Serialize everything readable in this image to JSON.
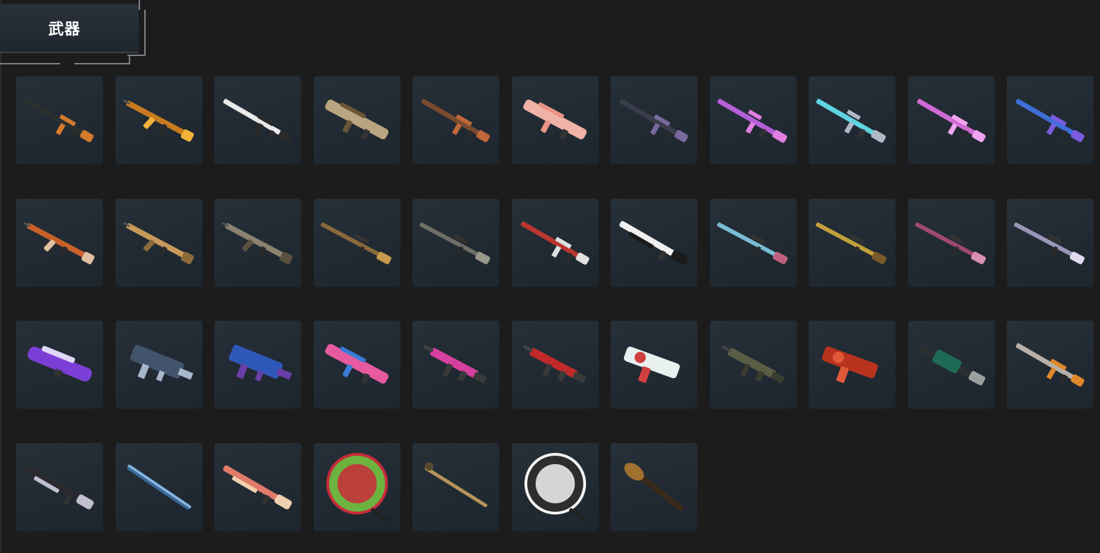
{
  "header": {
    "tab_label": "武器"
  },
  "colors": {
    "background": "#1c1c1d",
    "tile": "#222b34",
    "tab": "#262d35"
  },
  "items": [
    {
      "kind": "rifle",
      "c1": "#2b2f2e",
      "c2": "#d67a2d"
    },
    {
      "kind": "ak",
      "c1": "#c87b1e",
      "c2": "#f0b23a"
    },
    {
      "kind": "rifle",
      "c1": "#e9e9e9",
      "c2": "#2a2a2a"
    },
    {
      "kind": "bullpup",
      "c1": "#b9a57f",
      "c2": "#6b5538"
    },
    {
      "kind": "rifle",
      "c1": "#7a4a2e",
      "c2": "#c0683a"
    },
    {
      "kind": "bullpup",
      "c1": "#efb2a7",
      "c2": "#e99486"
    },
    {
      "kind": "rifle",
      "c1": "#3a3d4c",
      "c2": "#7a6aa0"
    },
    {
      "kind": "m16",
      "c1": "#b65fd8",
      "c2": "#e07fe0"
    },
    {
      "kind": "m16",
      "c1": "#5fd3e0",
      "c2": "#b0b8c8"
    },
    {
      "kind": "rifle",
      "c1": "#d06bd6",
      "c2": "#f3a4f0"
    },
    {
      "kind": "rifle",
      "c1": "#3f6ed8",
      "c2": "#7b5ce0"
    },
    {
      "kind": "ak",
      "c1": "#c8602a",
      "c2": "#e0c0a0"
    },
    {
      "kind": "ak",
      "c1": "#c89a5a",
      "c2": "#8a6a3a"
    },
    {
      "kind": "ak",
      "c1": "#8c8270",
      "c2": "#5a5040"
    },
    {
      "kind": "sniper",
      "c1": "#8a6a3c",
      "c2": "#c79a4e"
    },
    {
      "kind": "sniper",
      "c1": "#6e6e64",
      "c2": "#9a9a8a"
    },
    {
      "kind": "rifle",
      "c1": "#b9362f",
      "c2": "#e0e0e0"
    },
    {
      "kind": "shotgun",
      "c1": "#f0f0f0",
      "c2": "#1a1a1a"
    },
    {
      "kind": "sniper",
      "c1": "#7abcd4",
      "c2": "#c06080"
    },
    {
      "kind": "sniper",
      "c1": "#c2a13a",
      "c2": "#7a5a2a"
    },
    {
      "kind": "sniper",
      "c1": "#a04870",
      "c2": "#d890b0"
    },
    {
      "kind": "sniper",
      "c1": "#9a96b8",
      "c2": "#e2d8f0"
    },
    {
      "kind": "p90",
      "c1": "#7b3fd6",
      "c2": "#e0d6f8"
    },
    {
      "kind": "vector",
      "c1": "#42546c",
      "c2": "#a8b6cc"
    },
    {
      "kind": "vector",
      "c1": "#2f57b8",
      "c2": "#6a3fa8"
    },
    {
      "kind": "bullpup",
      "c1": "#e85aa0",
      "c2": "#3b7bd8"
    },
    {
      "kind": "smg",
      "c1": "#d6409e",
      "c2": "#3a3a3a"
    },
    {
      "kind": "smg",
      "c1": "#c02a2a",
      "c2": "#3a3a3a"
    },
    {
      "kind": "uzi",
      "c1": "#e8f0f0",
      "c2": "#d04040"
    },
    {
      "kind": "smg",
      "c1": "#5a5e44",
      "c2": "#3a3c30"
    },
    {
      "kind": "uzi",
      "c1": "#b8321e",
      "c2": "#e05a3a"
    },
    {
      "kind": "lmg",
      "c1": "#1f6a55",
      "c2": "#2a2f30"
    },
    {
      "kind": "rifle",
      "c1": "#b8b0a8",
      "c2": "#e0882a"
    },
    {
      "kind": "shotgun",
      "c1": "#2a2a2e",
      "c2": "#c0c0d0"
    },
    {
      "kind": "melee",
      "c1": "#3b6a9a",
      "c2": "#b8e0ff"
    },
    {
      "kind": "shotgun",
      "c1": "#e27a6a",
      "c2": "#f0d0b0"
    },
    {
      "kind": "pan",
      "c1": "#6cb340",
      "c2": "#c92a3a"
    },
    {
      "kind": "cane",
      "c1": "#b8935a",
      "c2": "#5a4a30"
    },
    {
      "kind": "pan",
      "c1": "#2d2d2d",
      "c2": "#f4f4f4"
    },
    {
      "kind": "mace",
      "c1": "#a0702e",
      "c2": "#3a2a1a"
    }
  ]
}
